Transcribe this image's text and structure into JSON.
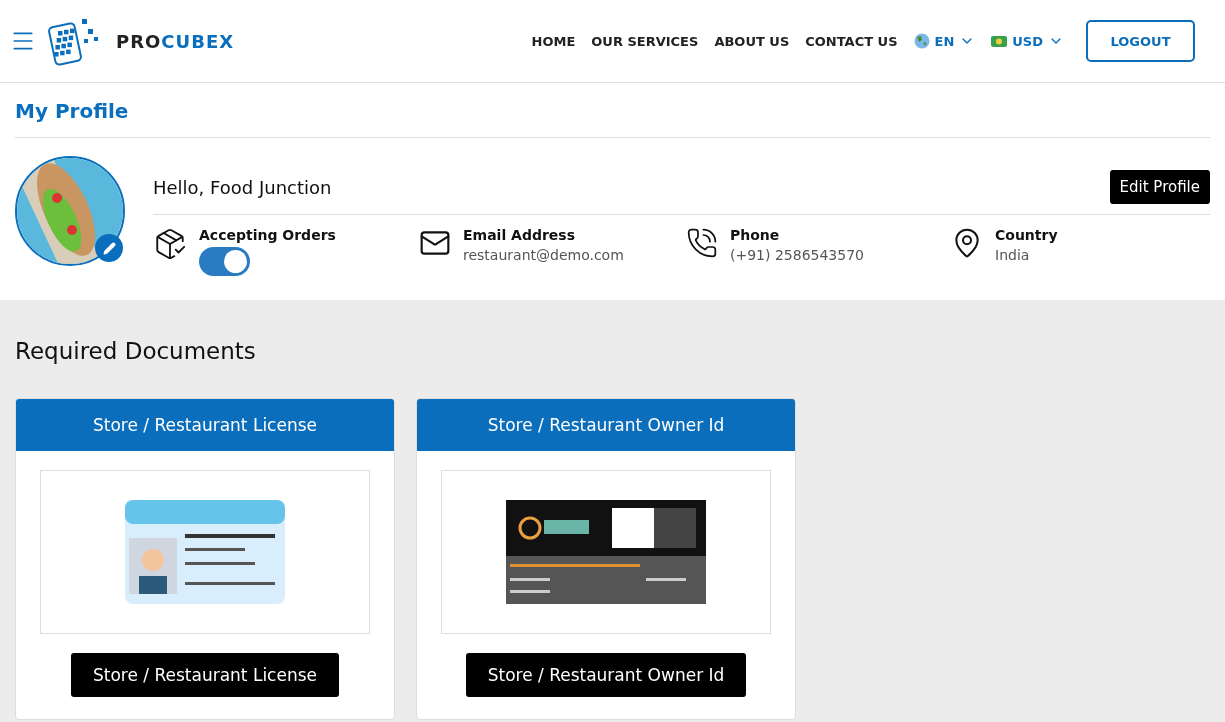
{
  "header": {
    "brand_dark": "PRO",
    "brand_accent": "CUBEX",
    "nav": [
      "HOME",
      "OUR SERVICES",
      "ABOUT US",
      "CONTACT US"
    ],
    "language": "EN",
    "currency": "USD",
    "logout": "LOGOUT"
  },
  "profile": {
    "title": "My Profile",
    "greeting": "Hello, Food Junction",
    "edit_button": "Edit Profile",
    "accepting": {
      "label": "Accepting Orders",
      "on": true
    },
    "info": [
      {
        "kind": "email",
        "label": "Email Address",
        "value": "restaurant@demo.com"
      },
      {
        "kind": "phone",
        "label": "Phone",
        "value": "(+91) 2586543570"
      },
      {
        "kind": "country",
        "label": "Country",
        "value": "India"
      }
    ]
  },
  "documents": {
    "title": "Required Documents",
    "cards": [
      {
        "kind": "license",
        "title": "Store / Restaurant License",
        "button": "Store / Restaurant License"
      },
      {
        "kind": "owner_id",
        "title": "Store / Restaurant Owner Id",
        "button": "Store / Restaurant Owner Id"
      }
    ]
  }
}
